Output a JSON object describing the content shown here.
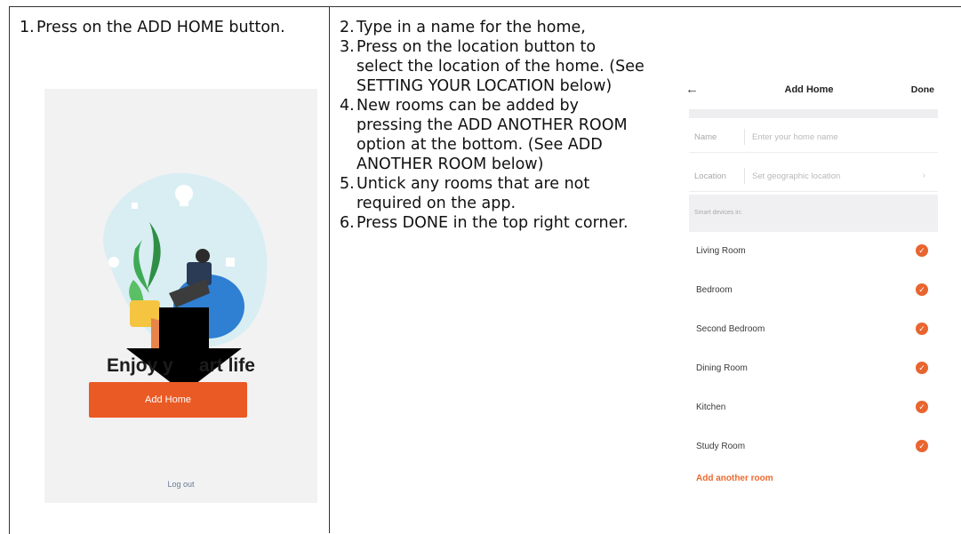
{
  "steps_left": [
    {
      "num": "1.",
      "text": "Press on the ADD HOME button."
    }
  ],
  "steps_right": [
    {
      "num": "2.",
      "text": "Type in a name for the home,"
    },
    {
      "num": "3.",
      "text": "Press on the location button to select the location of the home. (See SETTING YOUR LOCATION below)"
    },
    {
      "num": "4.",
      "text": "New rooms can be added by pressing the ADD ANOTHER ROOM option at the bottom. (See ADD ANOTHER ROOM below)"
    },
    {
      "num": "5.",
      "text": "Untick any rooms that are not required on the app."
    },
    {
      "num": "6.",
      "text": "Press DONE in the top right corner."
    }
  ],
  "left_screen": {
    "tagline": "Enjoy y     art life",
    "add_home_button": "Add Home",
    "logout_link": "Log out",
    "accent_color": "#ea5a24"
  },
  "right_screen": {
    "back_icon": "arrow-left-icon",
    "title": "Add Home",
    "done_label": "Done",
    "name_label": "Name",
    "name_placeholder": "Enter your home name",
    "location_label": "Location",
    "location_placeholder": "Set geographic location",
    "location_chevron": "›",
    "rooms_header": "Smart devices in:",
    "rooms": [
      "Living Room",
      "Bedroom",
      "Second Bedroom",
      "Dining Room",
      "Kitchen",
      "Study Room"
    ],
    "add_room_label": "Add another room",
    "check_color": "#e8652f"
  }
}
